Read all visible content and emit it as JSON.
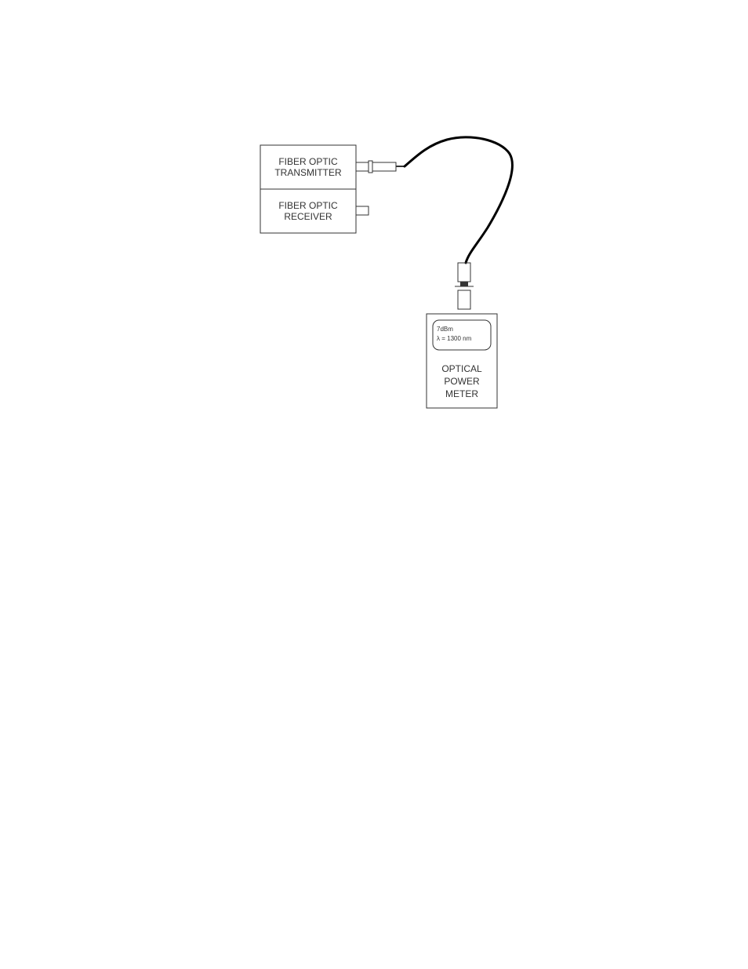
{
  "transceiver": {
    "transmitter_label_line1": "FIBER OPTIC",
    "transmitter_label_line2": "TRANSMITTER",
    "receiver_label_line1": "FIBER OPTIC",
    "receiver_label_line2": "RECEIVER"
  },
  "meter": {
    "display_line1": "7dBm",
    "display_line2": "λ = 1300 nm",
    "label_line1": "OPTICAL",
    "label_line2": "POWER",
    "label_line3": "METER"
  },
  "chart_data": {
    "type": "diagram",
    "components": [
      {
        "name": "Fiber Optic Transmitter",
        "role": "source"
      },
      {
        "name": "Fiber Optic Receiver",
        "role": "unused-port"
      },
      {
        "name": "Fiber Optic Cable",
        "role": "link",
        "from": "Fiber Optic Transmitter",
        "to": "Optical Power Meter"
      },
      {
        "name": "Optical Power Meter",
        "role": "measurement",
        "reading": "7dBm",
        "wavelength": "1300 nm"
      }
    ],
    "title": "",
    "notes": "Transmitter connected via fiber cable to optical power meter for output power measurement."
  }
}
